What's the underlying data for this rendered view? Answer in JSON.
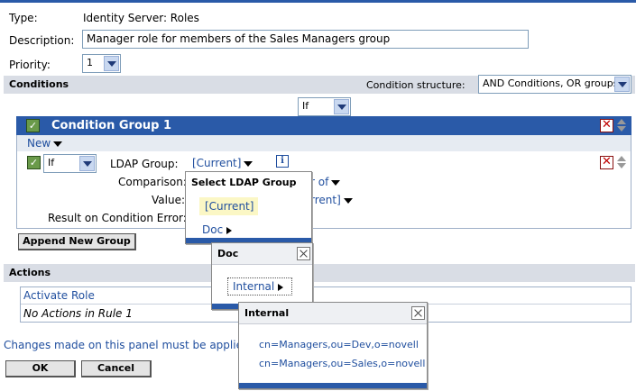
{
  "header": {
    "type_label": "Type:",
    "type_value": "Identity Server: Roles",
    "description_label": "Description:",
    "description_value": "Manager role for members of the Sales Managers group",
    "priority_label": "Priority:",
    "priority_value": "1"
  },
  "conditions": {
    "title": "Conditions",
    "structure_label": "Condition structure:",
    "structure_value": "AND Conditions, OR groups",
    "if_value": "If",
    "group": {
      "title": "Condition Group 1",
      "new_label": "New",
      "row": {
        "if_value": "If",
        "ldap_group_label": "LDAP Group:",
        "ldap_group_value": "[Current]",
        "comparison_label": "Comparison:",
        "comparison_value": "r of",
        "value_label": "Value:",
        "value_value": "rrent]",
        "result_label": "Result on Condition Error:"
      }
    },
    "append_group_label": "Append New Group"
  },
  "actions": {
    "title": "Actions",
    "activate_label": "Activate Role",
    "no_actions_text": "No Actions in Rule 1"
  },
  "footer": {
    "notice": "Changes made on this panel must be applied fr",
    "ok_label": "OK",
    "cancel_label": "Cancel"
  },
  "popups": {
    "select_ldap": {
      "title": "Select LDAP Group",
      "items": [
        "[Current]",
        "Doc"
      ]
    },
    "doc": {
      "title": "Doc",
      "items": [
        "Internal"
      ]
    },
    "internal": {
      "title": "Internal",
      "items": [
        "cn=Managers,ou=Dev,o=novell",
        "cn=Managers,ou=Sales,o=novell"
      ]
    }
  },
  "colors": {
    "group_header": "#2a5aa8",
    "section_bar": "#d9dde5",
    "link": "#1f4e9e",
    "highlight": "#fbf7c5"
  }
}
